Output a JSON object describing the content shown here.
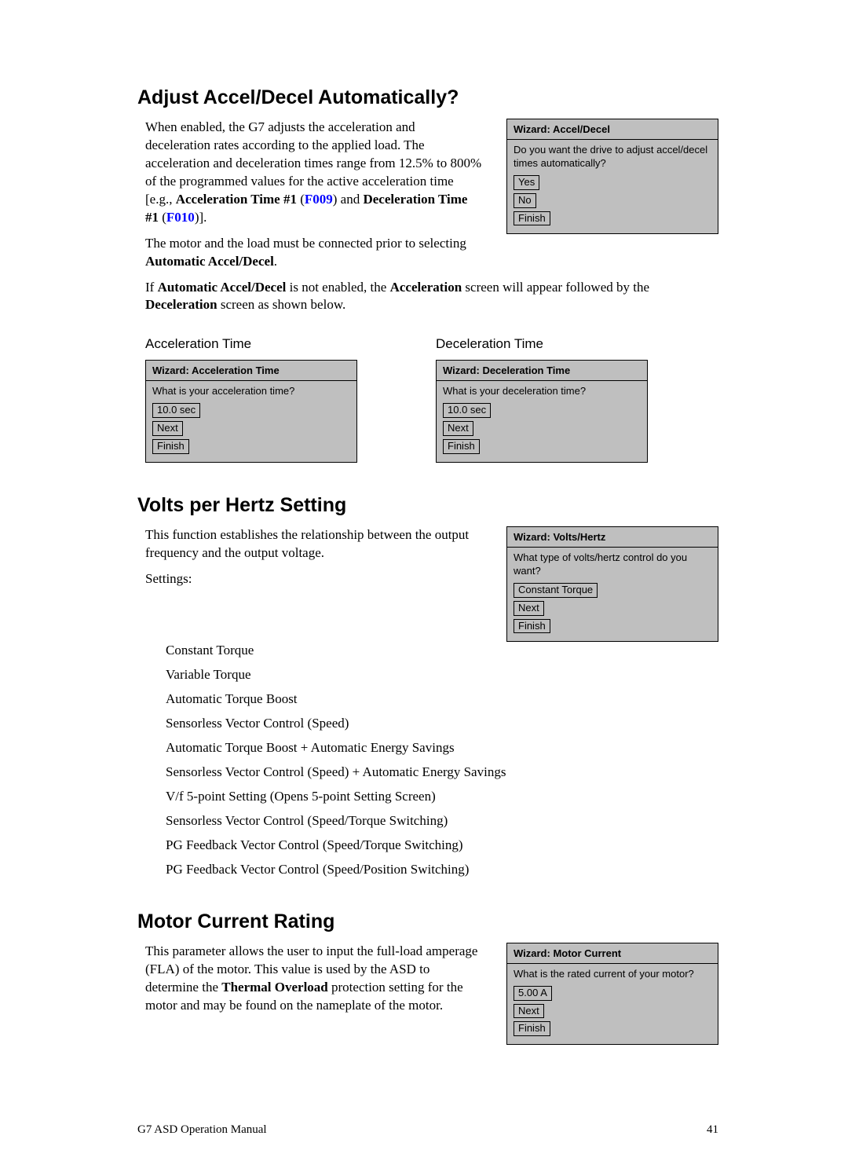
{
  "section1": {
    "title": "Adjust Accel/Decel Automatically?",
    "para1a": "When enabled, the G7 adjusts the acceleration and deceleration rates according to the applied load. The acceleration and deceleration times range from 12.5% to 800% of the programmed values for the active acceleration time [e.g., ",
    "para1_bold1": "Acceleration Time #1",
    "para1_link1": "F009",
    "para1_mid": ") and ",
    "para1_bold2": "Deceleration Time #1",
    "para1_link2": "F010",
    "para1_end": ")].",
    "para2a": "The motor and the load must be connected prior to selecting ",
    "para2_bold": "Automatic Accel/Decel",
    "para2b": ".",
    "para3a": "If ",
    "para3_bold1": "Automatic Accel/Decel",
    "para3_mid1": " is not enabled, the ",
    "para3_bold2": "Acceleration",
    "para3_mid2": " screen will appear followed by the ",
    "para3_bold3": "Deceleration",
    "para3_end": " screen as shown below.",
    "wizard": {
      "header": "Wizard: Accel/Decel",
      "question": "Do you want the drive to adjust accel/decel times automatically?",
      "btn_yes": "Yes",
      "btn_no": "No",
      "btn_finish": "Finish"
    },
    "sub_accel_title": "Acceleration Time",
    "sub_decel_title": "Deceleration Time",
    "wiz_accel": {
      "header": "Wizard: Acceleration Time",
      "question": "What is your acceleration time?",
      "value": "10.0 sec",
      "btn_next": "Next",
      "btn_finish": "Finish"
    },
    "wiz_decel": {
      "header": "Wizard: Deceleration Time",
      "question": "What is your deceleration time?",
      "value": "10.0 sec",
      "btn_next": "Next",
      "btn_finish": "Finish"
    }
  },
  "section2": {
    "title": "Volts per Hertz Setting",
    "para1": "This function establishes the relationship between the output frequency and the output voltage.",
    "settings_label": "Settings:",
    "settings": [
      "Constant Torque",
      "Variable Torque",
      "Automatic Torque Boost",
      "Sensorless Vector Control (Speed)",
      "Automatic Torque Boost + Automatic Energy Savings",
      "Sensorless Vector Control (Speed) + Automatic Energy Savings",
      "V/f 5-point Setting (Opens 5-point Setting Screen)",
      "Sensorless Vector Control (Speed/Torque Switching)",
      "PG Feedback Vector Control (Speed/Torque Switching)",
      "PG Feedback Vector Control (Speed/Position Switching)"
    ],
    "wizard": {
      "header": "Wizard: Volts/Hertz",
      "question": "What type of volts/hertz control do you want?",
      "value": "Constant Torque",
      "btn_next": "Next",
      "btn_finish": "Finish"
    }
  },
  "section3": {
    "title": "Motor Current Rating",
    "para1a": "This parameter allows the user to input the full-load amperage (FLA) of the motor. This value is used by the ASD to determine the ",
    "para1_bold": "Thermal Overload",
    "para1b": " protection setting for the motor and may be found on the nameplate of the motor.",
    "wizard": {
      "header": "Wizard: Motor Current",
      "question": "What is the rated current of your motor?",
      "value": "5.00 A",
      "btn_next": "Next",
      "btn_finish": "Finish"
    }
  },
  "footer": {
    "left": "G7 ASD Operation Manual",
    "right": "41"
  }
}
